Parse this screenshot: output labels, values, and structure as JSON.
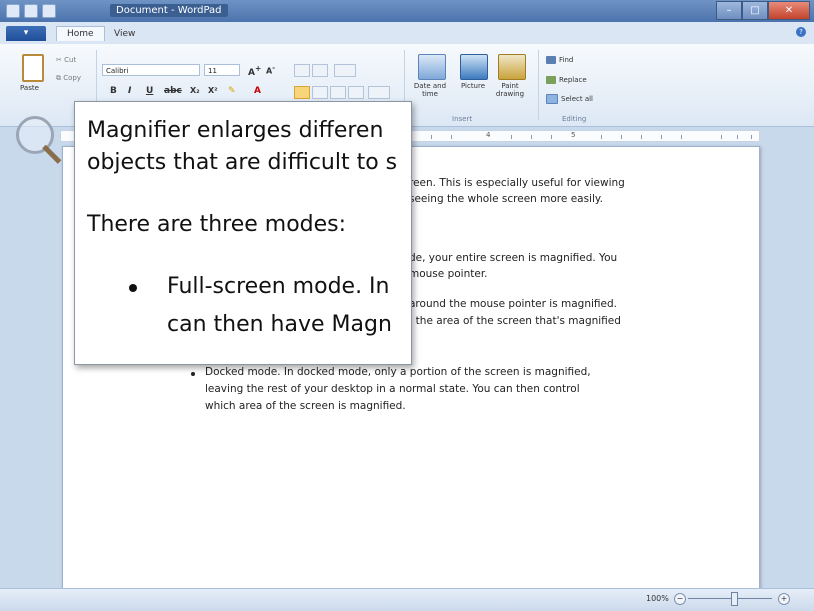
{
  "window": {
    "title": "Document - WordPad"
  },
  "tabs": {
    "file": "",
    "home": "Home",
    "view": "View"
  },
  "ribbon": {
    "clipboard": {
      "paste": "Paste",
      "cut": "Cut",
      "copy": "Copy"
    },
    "font": {
      "family": "Calibri",
      "size": "11"
    },
    "insert": {
      "date_time": "Date and time",
      "picture": "Picture",
      "paint": "Paint drawing",
      "group_label": "Insert"
    },
    "editing": {
      "find": "Find",
      "replace": "Replace",
      "select_all": "Select all",
      "group_label": "Editing"
    }
  },
  "ruler": {
    "numbers": [
      "4",
      "5"
    ]
  },
  "document": {
    "visible_lines": [
      "reen. This is especially useful for viewing",
      "seeing the whole screen more easily.",
      "de, your entire screen is magnified. You",
      "mouse pointer.",
      "around the mouse pointer is magnified.",
      ", the area of the screen that's magnified",
      "Docked mode. In docked mode, only a portion of the screen is magnified,",
      "leaving the rest of your desktop in a normal state. You can then control",
      "which area of the screen is magnified."
    ]
  },
  "lens": {
    "line1": "Magnifier enlarges differen",
    "line2": "objects that are difficult to s",
    "line3": "There are three modes:",
    "line4": "Full-screen mode. In",
    "line5": "can then have Magn"
  },
  "statusbar": {
    "zoom": "100%",
    "zoom_level": 1.0,
    "minus": "−",
    "plus": "+"
  },
  "colors": {
    "titlebar": "#4c73ad",
    "ribbon": "#dde8f5",
    "workspace": "#c9d9ec",
    "close": "#c2432c"
  }
}
